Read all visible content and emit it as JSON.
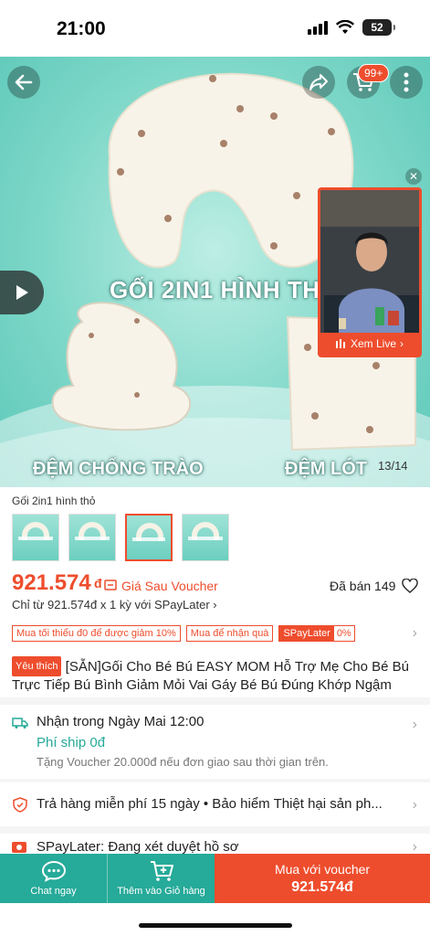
{
  "status_bar": {
    "time": "21:00",
    "battery": "52"
  },
  "hero": {
    "cart_badge": "99+",
    "title_text": "GỐI 2IN1 HÌNH TH",
    "label_left": "ĐỆM CHỐNG TRÀO",
    "label_right": "ĐỆM LÓT",
    "image_counter": "13/14",
    "live_button": "Xem Live"
  },
  "product": {
    "variant_name": "Gối 2in1 hình thỏ",
    "price": "921.574",
    "currency": "đ",
    "price_note": "Giá Sau Voucher",
    "sold": "Đã bán 149",
    "installment": "Chỉ từ 921.574đ x 1 kỳ với SPayLater",
    "promos": [
      "Mua tối thiểu đ0 để được giảm 10%",
      "Mua để nhận quà"
    ],
    "spaylater_tag": "SPayLater",
    "spaylater_value": "0%",
    "fav_tag": "Yêu thích",
    "title": "[SẴN]Gối Cho Bé Bú EASY MOM Hỗ Trợ Mẹ Cho Bé Bú Trực Tiếp Bú Bình Giảm Mỏi Vai Gáy Bé Bú Đúng Khớp Ngậm"
  },
  "shipping": {
    "title": "Nhận trong Ngày Mai 12:00",
    "fee": "Phí ship 0đ",
    "note": "Tặng Voucher 20.000đ nếu đơn giao sau thời gian trên."
  },
  "guarantee": {
    "text": "Trả hàng miễn phí 15 ngày  •  Bảo hiểm Thiệt hại sản ph..."
  },
  "spaylater_row": {
    "text": "SPayLater: Đang xét duyệt hồ sơ"
  },
  "bottom_bar": {
    "chat": "Chat ngay",
    "add_cart": "Thêm vào Giỏ hàng",
    "buy_label": "Mua với voucher",
    "buy_price": "921.574đ"
  },
  "colors": {
    "brand": "#ee4d2d",
    "teal": "#26aa99"
  }
}
